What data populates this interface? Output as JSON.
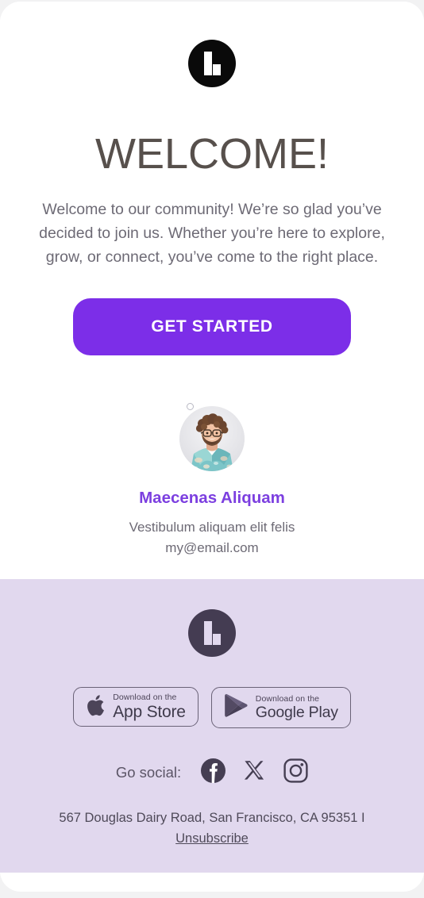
{
  "theme": {
    "page_background": "#f2f2f3",
    "card_background": "#ffffff",
    "footer_background": "#e1d8ee",
    "accent_purple": "#7c2ee8",
    "name_purple": "#7c3fe0",
    "heading_color": "#57504c",
    "body_text_color": "#6d6a75",
    "logo_dark": "#0a0a0a",
    "logo_footer": "#443c52"
  },
  "header": {
    "logo_icon": "brand-l-logo-icon",
    "logo_alt": "L"
  },
  "main": {
    "heading": "WELCOME!",
    "intro": "Welcome to our community! We’re so glad you’ve decided to join us. Whether you’re here to explore, grow, or connect, you’ve come to the right place.",
    "cta_label": "GET STARTED"
  },
  "profile": {
    "avatar_alt": "Portrait of a smiling bearded man with curly hair, glasses and a teal patterned shirt",
    "name": "Maecenas Aliquam",
    "tagline": "Vestibulum aliquam elit felis",
    "email": "my@email.com"
  },
  "footer": {
    "logo_icon": "brand-l-logo-icon",
    "badges": [
      {
        "icon": "apple-icon",
        "small_text": "Download on the",
        "large_text": "App Store"
      },
      {
        "icon": "google-play-icon",
        "small_text": "Download on the",
        "large_text": "Google Play"
      }
    ],
    "social_label": "Go social:",
    "social_icons": [
      {
        "name": "facebook-icon"
      },
      {
        "name": "x-twitter-icon"
      },
      {
        "name": "instagram-icon"
      }
    ],
    "address": "567 Douglas Dairy Road, San Francisco, CA 95351 I",
    "unsubscribe_label": "Unsubscribe"
  }
}
